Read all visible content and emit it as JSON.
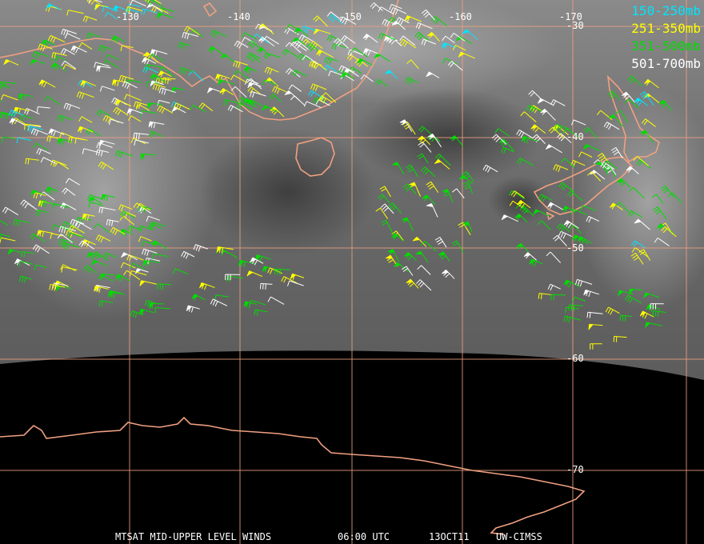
{
  "legend": [
    {
      "label": "150-250mb",
      "color": "#00e5ff"
    },
    {
      "label": "251-350mb",
      "color": "#ffff00"
    },
    {
      "label": "351-500mb",
      "color": "#00dd00"
    },
    {
      "label": "501-700mb",
      "color": "#ffffff"
    }
  ],
  "longitude_labels": [
    "-130",
    "-140",
    "-150",
    "-160",
    "-170"
  ],
  "latitude_labels": [
    "-30",
    "-40",
    "-50",
    "-60",
    "-70"
  ],
  "footer": {
    "product": "MTSAT MID-UPPER LEVEL WINDS",
    "time": "06:00 UTC",
    "date": "13OCT11",
    "credit": "UW-CIMSS"
  },
  "colors": {
    "coastline": "#f0a080",
    "gridline": "#f0a080",
    "night_side": "#000000",
    "cloud_gray": "#6a6a6a"
  }
}
